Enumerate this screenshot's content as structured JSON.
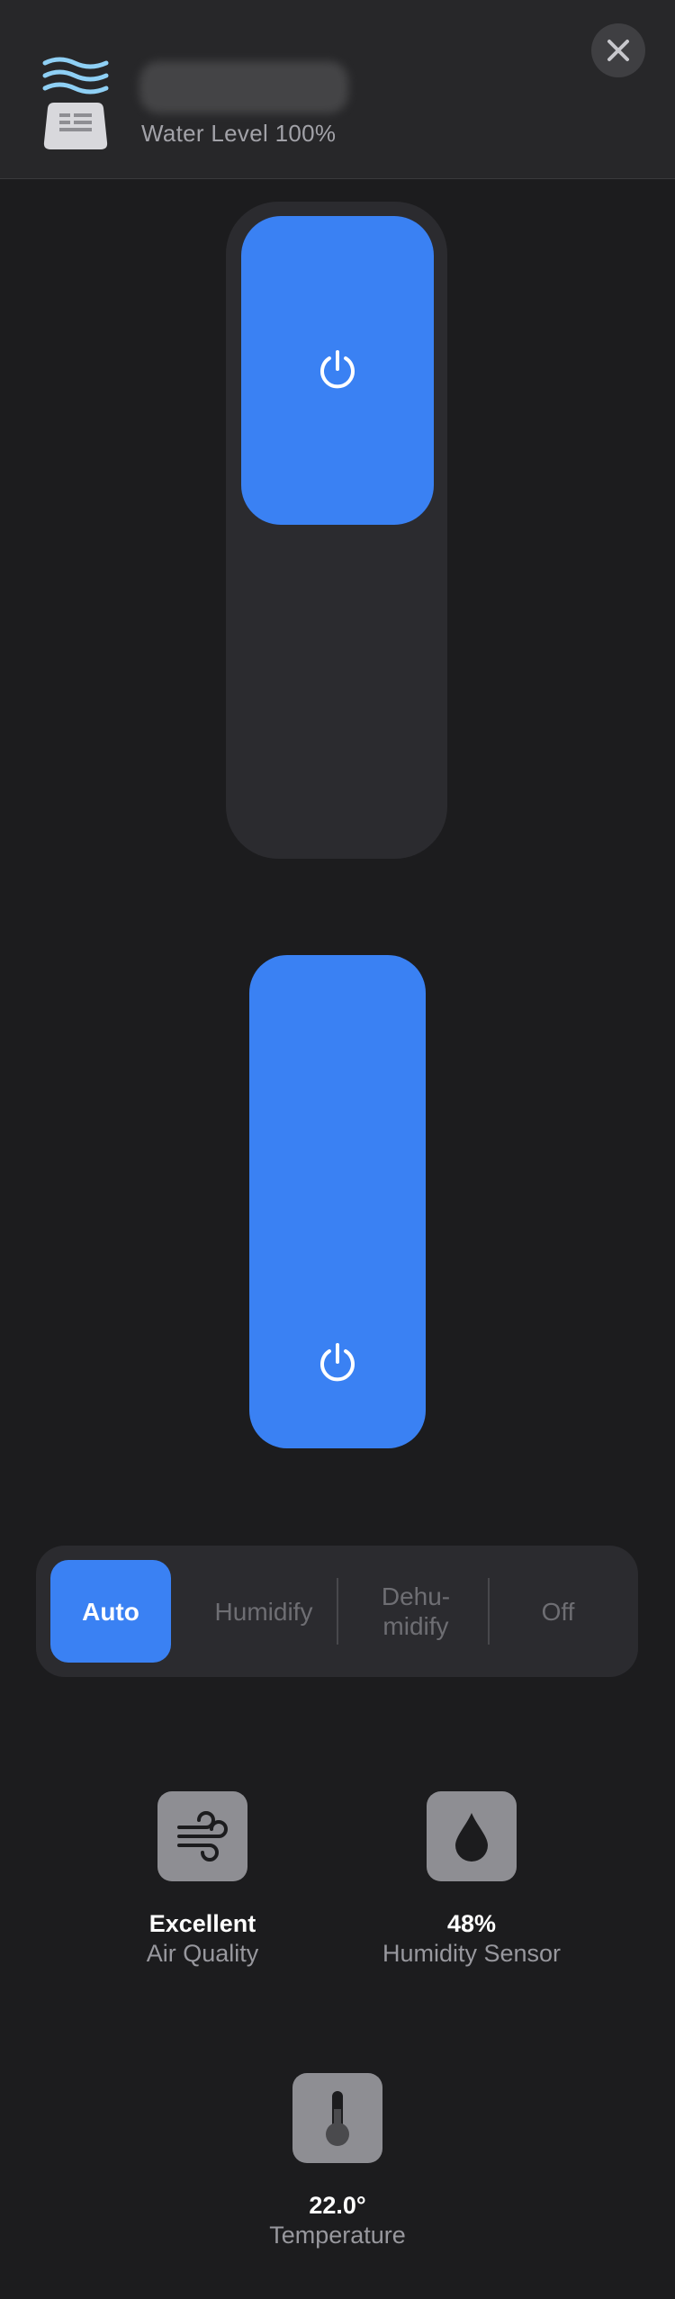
{
  "header": {
    "device_icon": "humidifier-icon",
    "device_name": "",
    "water_level": "Water Level 100%",
    "close_icon": "close-icon"
  },
  "humidity_slider": {
    "level_percent": 47,
    "icon": "power-icon"
  },
  "power_button": {
    "state": "on",
    "icon": "power-icon"
  },
  "mode_selector": {
    "selected": "Auto",
    "options": [
      "Auto",
      "Humidify",
      "Dehu-\nmidify",
      "Off"
    ]
  },
  "sensors": [
    {
      "value": "Excellent",
      "label": "Air Quality",
      "icon": "wind-icon"
    },
    {
      "value": "48%",
      "label": "Humidity Sensor",
      "icon": "water-drop-icon"
    },
    {
      "value": "22.0°",
      "label": "Temperature",
      "icon": "thermometer-icon"
    }
  ],
  "colors": {
    "accent": "#3a81f3",
    "background": "#1c1c1e",
    "header": "#272729",
    "tile": "#8e8e93"
  }
}
